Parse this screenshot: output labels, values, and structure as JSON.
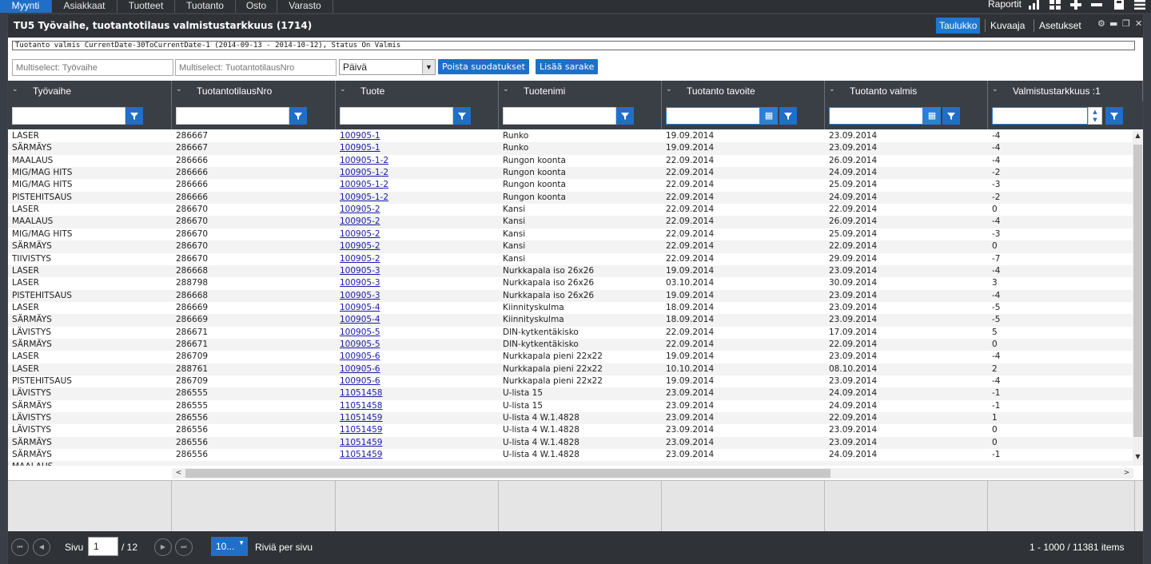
{
  "topnav": {
    "tabs": [
      "Myynti",
      "Asiakkaat",
      "Tuotteet",
      "Tuotanto",
      "Osto",
      "Varasto"
    ],
    "active": "Myynti",
    "raportit": "Raportit",
    "icons": [
      "bar-chart-icon",
      "grid-icon",
      "plus-icon",
      "minus-icon",
      "save-icon",
      "menu-icon"
    ]
  },
  "window": {
    "title": "TU5 Työvaihe, tuotantotilaus valmistustarkkuus (1714)",
    "views": [
      "Taulukko",
      "Kuvaaja",
      "Asetukset"
    ],
    "active_view": "Taulukko",
    "filter_info": "Tuotanto valmis CurrentDate-30ToCurrentDate-1 (2014-09-13 - 2014-10-12), Status On Valmis"
  },
  "toolbar": {
    "ms1_placeholder": "Multiselect: Työvaihe",
    "ms2_placeholder": "Multiselect: TuotantotilausNro",
    "select_value": "Päivä",
    "remove_filters": "Poista suodatukset",
    "add_column": "Lisää sarake"
  },
  "columns": [
    "Työvaihe",
    "TuotantotilausNro",
    "Tuote",
    "Tuotenimi",
    "Tuotanto tavoite",
    "Tuotanto valmis",
    "Valmistustarkkuus :1"
  ],
  "rows": [
    [
      "LASER",
      "286667",
      "100905-1",
      "Runko",
      "19.09.2014",
      "23.09.2014",
      "-4"
    ],
    [
      "SÄRMÄYS",
      "286667",
      "100905-1",
      "Runko",
      "19.09.2014",
      "23.09.2014",
      "-4"
    ],
    [
      "MAALAUS",
      "286666",
      "100905-1-2",
      "Rungon koonta",
      "22.09.2014",
      "26.09.2014",
      "-4"
    ],
    [
      "MIG/MAG HITS",
      "286666",
      "100905-1-2",
      "Rungon koonta",
      "22.09.2014",
      "24.09.2014",
      "-2"
    ],
    [
      "MIG/MAG HITS",
      "286666",
      "100905-1-2",
      "Rungon koonta",
      "22.09.2014",
      "25.09.2014",
      "-3"
    ],
    [
      "PISTEHITSAUS",
      "286666",
      "100905-1-2",
      "Rungon koonta",
      "22.09.2014",
      "24.09.2014",
      "-2"
    ],
    [
      "LASER",
      "286670",
      "100905-2",
      "Kansi",
      "22.09.2014",
      "22.09.2014",
      "0"
    ],
    [
      "MAALAUS",
      "286670",
      "100905-2",
      "Kansi",
      "22.09.2014",
      "26.09.2014",
      "-4"
    ],
    [
      "MIG/MAG HITS",
      "286670",
      "100905-2",
      "Kansi",
      "22.09.2014",
      "25.09.2014",
      "-3"
    ],
    [
      "SÄRMÄYS",
      "286670",
      "100905-2",
      "Kansi",
      "22.09.2014",
      "22.09.2014",
      "0"
    ],
    [
      "TIIVISTYS",
      "286670",
      "100905-2",
      "Kansi",
      "22.09.2014",
      "29.09.2014",
      "-7"
    ],
    [
      "LASER",
      "286668",
      "100905-3",
      "Nurkkapala iso 26x26",
      "19.09.2014",
      "23.09.2014",
      "-4"
    ],
    [
      "LASER",
      "288798",
      "100905-3",
      "Nurkkapala iso 26x26",
      "03.10.2014",
      "30.09.2014",
      "3"
    ],
    [
      "PISTEHITSAUS",
      "286668",
      "100905-3",
      "Nurkkapala iso 26x26",
      "19.09.2014",
      "23.09.2014",
      "-4"
    ],
    [
      "LASER",
      "286669",
      "100905-4",
      "Kiinnityskulma",
      "18.09.2014",
      "23.09.2014",
      "-5"
    ],
    [
      "SÄRMÄYS",
      "286669",
      "100905-4",
      "Kiinnityskulma",
      "18.09.2014",
      "23.09.2014",
      "-5"
    ],
    [
      "LÄVISTYS",
      "286671",
      "100905-5",
      "DIN-kytkentäkisko",
      "22.09.2014",
      "17.09.2014",
      "5"
    ],
    [
      "SÄRMÄYS",
      "286671",
      "100905-5",
      "DIN-kytkentäkisko",
      "22.09.2014",
      "22.09.2014",
      "0"
    ],
    [
      "LASER",
      "286709",
      "100905-6",
      "Nurkkapala pieni 22x22",
      "19.09.2014",
      "23.09.2014",
      "-4"
    ],
    [
      "LASER",
      "288761",
      "100905-6",
      "Nurkkapala pieni 22x22",
      "10.10.2014",
      "08.10.2014",
      "2"
    ],
    [
      "PISTEHITSAUS",
      "286709",
      "100905-6",
      "Nurkkapala pieni 22x22",
      "19.09.2014",
      "23.09.2014",
      "-4"
    ],
    [
      "LÄVISTYS",
      "286555",
      "11051458",
      "U-lista 15",
      "23.09.2014",
      "24.09.2014",
      "-1"
    ],
    [
      "SÄRMÄYS",
      "286555",
      "11051458",
      "U-lista 15",
      "23.09.2014",
      "24.09.2014",
      "-1"
    ],
    [
      "LÄVISTYS",
      "286556",
      "11051459",
      "U-lista 4 W.1.4828",
      "23.09.2014",
      "22.09.2014",
      "1"
    ],
    [
      "LÄVISTYS",
      "286556",
      "11051459",
      "U-lista 4 W.1.4828",
      "23.09.2014",
      "23.09.2014",
      "0"
    ],
    [
      "SÄRMÄYS",
      "286556",
      "11051459",
      "U-lista 4 W.1.4828",
      "23.09.2014",
      "23.09.2014",
      "0"
    ],
    [
      "SÄRMÄYS",
      "286556",
      "11051459",
      "U-lista 4 W.1.4828",
      "23.09.2014",
      "24.09.2014",
      "-1"
    ],
    [
      "MAALAUS",
      "",
      "",
      "",
      "",
      "",
      ""
    ]
  ],
  "pager": {
    "page_label": "Sivu",
    "page_value": "1",
    "page_total": "/ 12",
    "page_size": "10...",
    "per_page_label": "Riviä per sivu",
    "items_info": "1 - 1000 / 11381 items"
  }
}
